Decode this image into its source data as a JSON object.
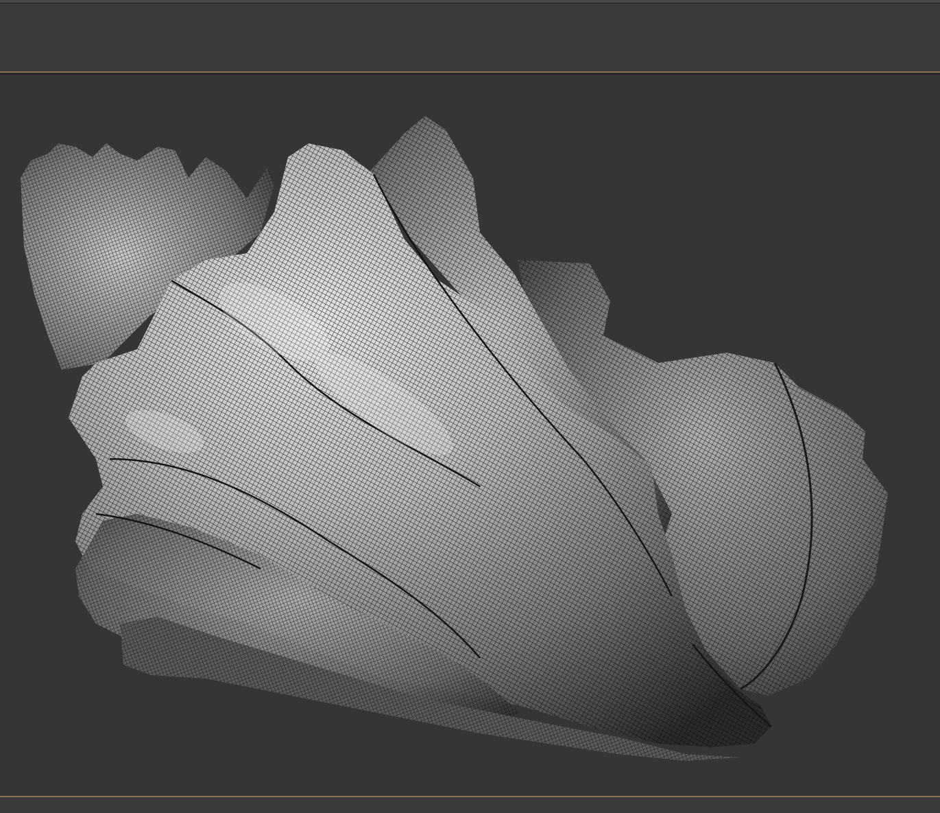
{
  "app": {
    "window_title": ""
  },
  "viewport": {
    "object": "shell-mesh",
    "render_mode": "wireframe-over-shaded",
    "background_color": "#353535",
    "frame_accent_color": "#8a7350",
    "mesh_highlight_color": "#d9d9d9",
    "mesh_shadow_color": "#1a1a1a"
  },
  "icons": {
    "model": "seashell-3d-model"
  }
}
